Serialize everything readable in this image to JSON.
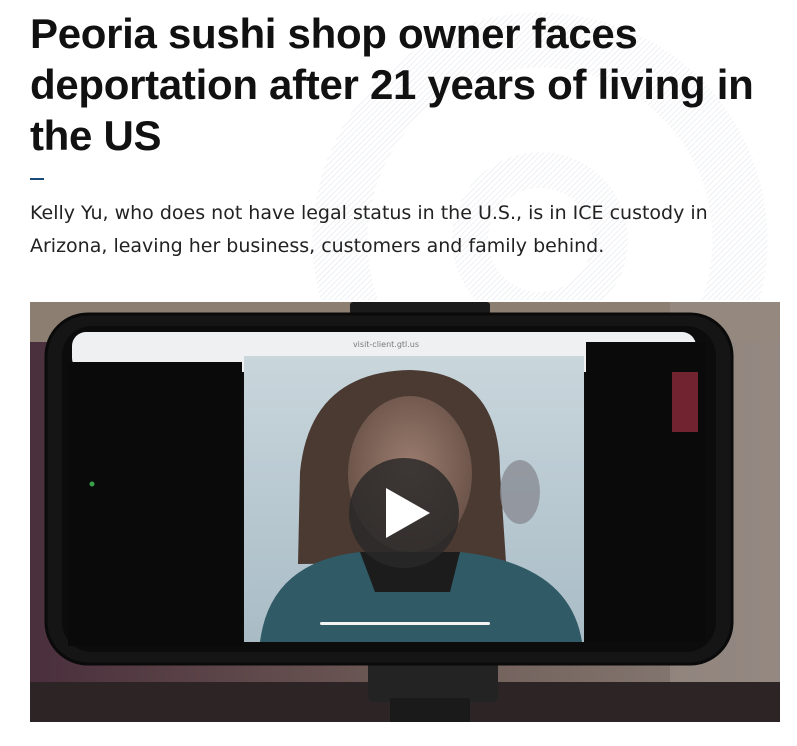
{
  "article": {
    "headline": "Peoria sushi shop owner faces deportation after 21 years of living in the US",
    "dek": "Kelly Yu, who does not have legal status in the U.S., is in ICE custody in Arizona, leaving her business, customers and family behind."
  },
  "video": {
    "phone_screen_url": "visit-client.gtl.us",
    "play_icon": "play-icon"
  },
  "colors": {
    "headline": "#111111",
    "accent_rule": "#1a4a7a",
    "body_text": "#222222"
  }
}
